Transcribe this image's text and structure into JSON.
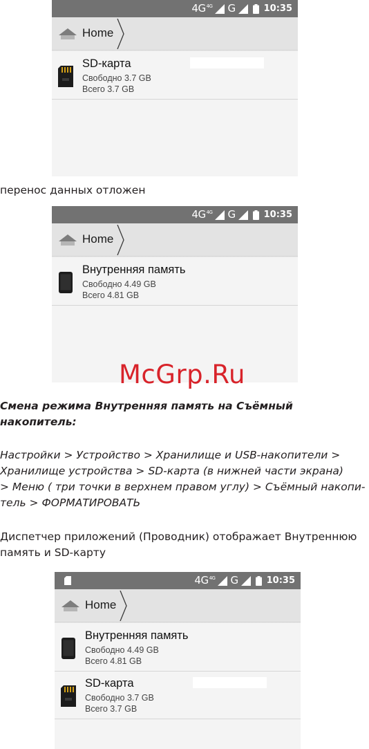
{
  "screens": [
    {
      "status": {
        "network": "4G",
        "network_sup": "4G",
        "network2": "G",
        "time": "10:35",
        "sd_indicator": false
      },
      "breadcrumb": {
        "label": "Home"
      },
      "items": [
        {
          "kind": "sd",
          "name": "SD-карта",
          "free": "Свободно 3.7 GB",
          "total": "Всего 3.7 GB"
        }
      ]
    },
    {
      "status": {
        "network": "4G",
        "network_sup": "4G",
        "network2": "G",
        "time": "10:35",
        "sd_indicator": false
      },
      "breadcrumb": {
        "label": "Home"
      },
      "items": [
        {
          "kind": "phone",
          "name": "Внутренняя память",
          "free": "Свободно 4.49 GB",
          "total": "Всего 4.81 GB"
        }
      ]
    },
    {
      "status": {
        "network": "4G",
        "network_sup": "4G",
        "network2": "G",
        "time": "10:35",
        "sd_indicator": true
      },
      "breadcrumb": {
        "label": "Home"
      },
      "items": [
        {
          "kind": "phone",
          "name": "Внутренняя память",
          "free": "Свободно 4.49 GB",
          "total": "Всего 4.81 GB"
        },
        {
          "kind": "sd",
          "name": "SD-карта",
          "free": "Свободно 3.7 GB",
          "total": "Всего 3.7 GB"
        }
      ]
    }
  ],
  "text": {
    "deferred": "перенос данных отложен",
    "heading_line1": "Смена режима Внутренняя память на Съёмный",
    "heading_line2": "накопитель:",
    "path_line1": "Настройки > Устройство > Хранилище и USB-накопители >",
    "path_line2": "Хранилище устройства  > SD-карта  (в нижней части экрана)",
    "path_line3": "> Меню ( три точки в верхнем правом углу) > Съёмный накопи-",
    "path_line4": "тель > ФОРМАТИРОВАТЬ",
    "explorer_line1": "Диспетчер приложений (Проводник) отображает Внутреннюю",
    "explorer_line2": "память и SD-карту"
  },
  "watermark": "McGrp.Ru",
  "colors": {
    "statusbar": "#727272",
    "breadcrumb_bar": "#e3e3e3",
    "screen_bg": "#f4f4f4",
    "watermark": "#d8232a"
  },
  "icons": {
    "breadcrumb": "home-icon",
    "sd": "sd-card-icon",
    "phone": "phone-icon",
    "signal": "signal-icon",
    "battery": "battery-icon"
  }
}
